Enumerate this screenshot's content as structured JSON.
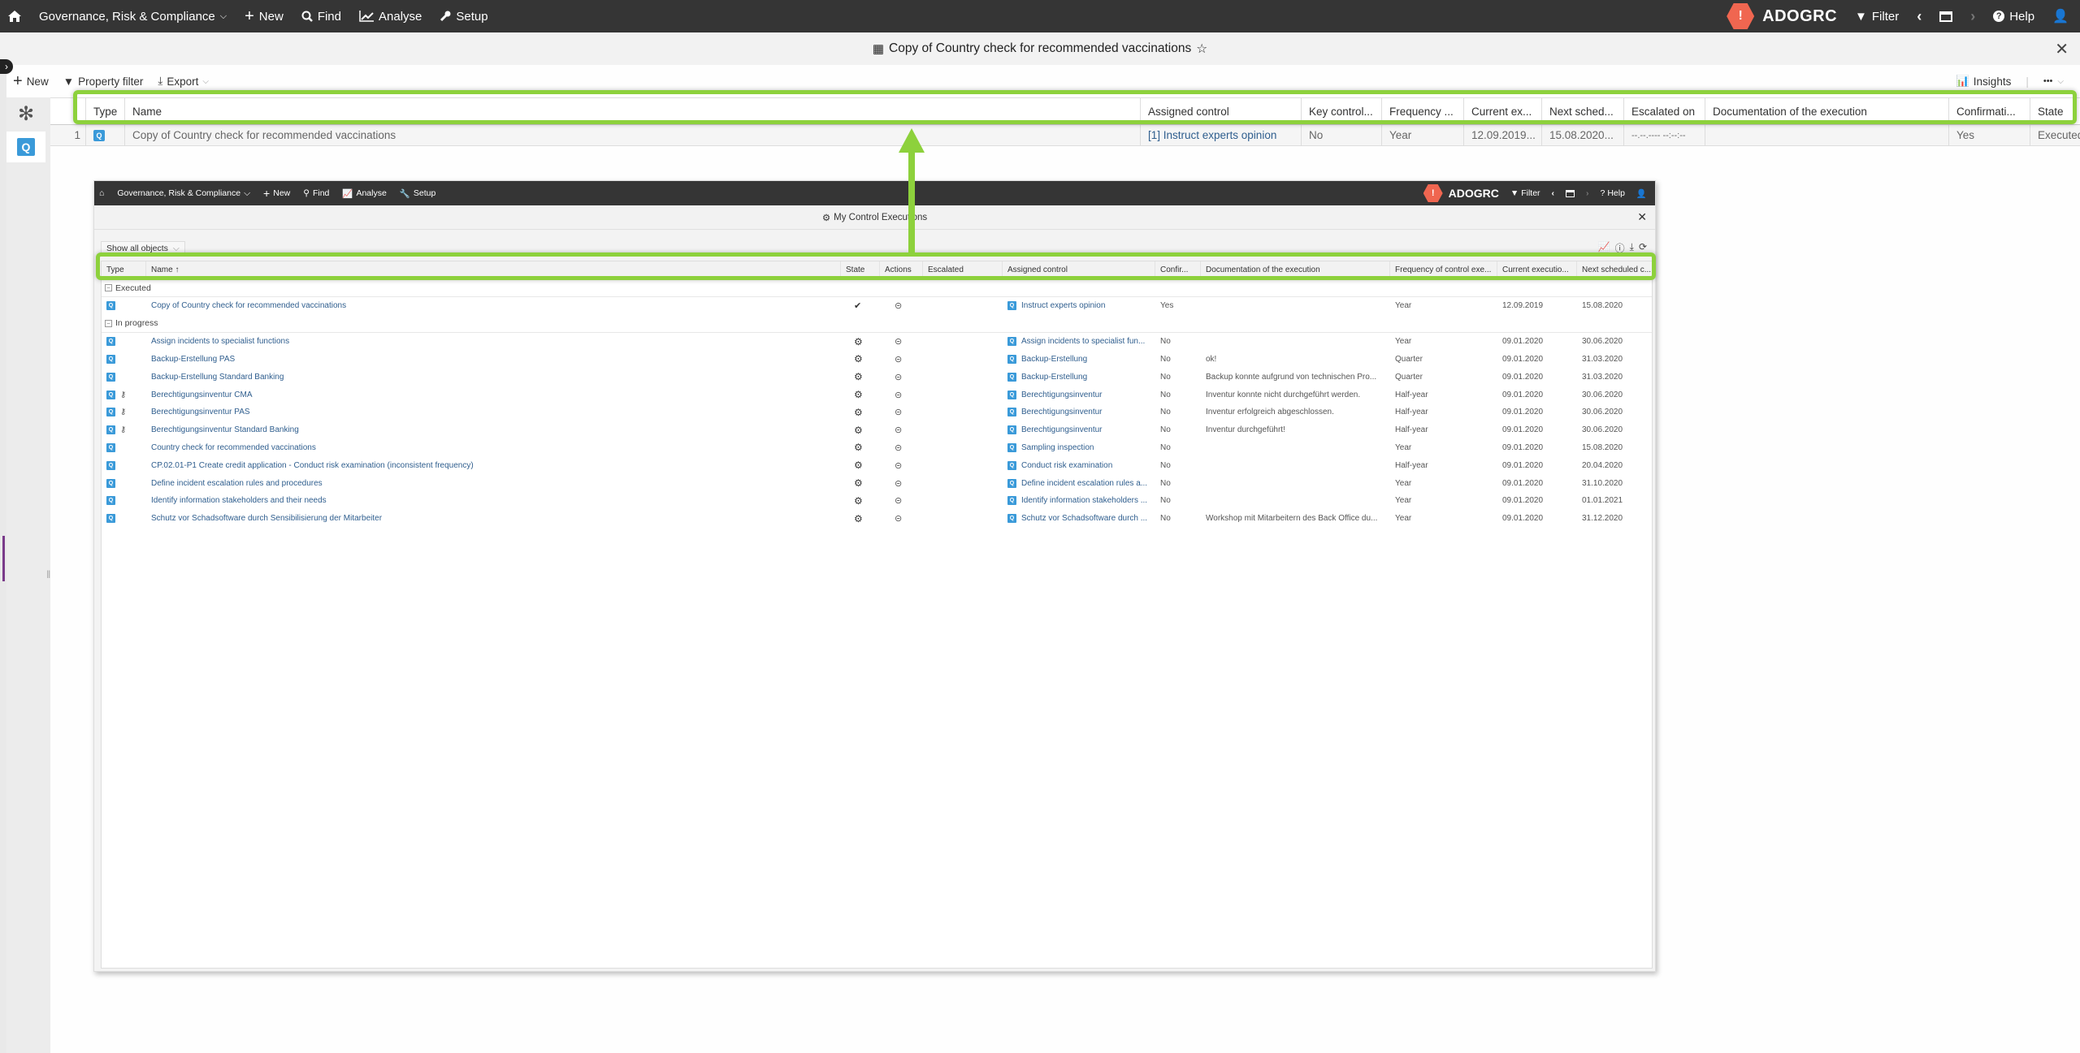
{
  "topnav": {
    "app_menu": "Governance, Risk & Compliance",
    "new": "New",
    "find": "Find",
    "analyse": "Analyse",
    "setup": "Setup",
    "logo": "ADOGRC",
    "filter": "Filter",
    "help": "Help"
  },
  "titlebar": {
    "title": "Copy of Country check for recommended vaccinations",
    "star": "☆",
    "close": "✕"
  },
  "toolbar": {
    "new": "New",
    "property_filter": "Property filter",
    "export": "Export",
    "insights": "Insights",
    "more": "•••"
  },
  "main_table": {
    "headers": [
      "Type",
      "Name",
      "Assigned control",
      "Key control...",
      "Frequency ...",
      "Current ex...",
      "Next sched...",
      "Escalated on",
      "Documentation of the execution",
      "Confirmati...",
      "State"
    ],
    "rows": [
      {
        "num": "1",
        "name": "Copy of Country check for recommended vaccinations",
        "assigned": "[1] Instruct experts opinion",
        "key": "No",
        "freq": "Year",
        "current": "12.09.2019...",
        "next": "15.08.2020...",
        "escalated": "--.--.---- --:--:--",
        "doc": "",
        "confirm": "Yes",
        "state": "Executed"
      }
    ]
  },
  "inner": {
    "nav": {
      "app_menu": "Governance, Risk & Compliance",
      "new": "New",
      "find": "Find",
      "analyse": "Analyse",
      "setup": "Setup",
      "logo": "ADOGRC",
      "filter": "Filter",
      "help": "Help"
    },
    "title": "My Control Executions",
    "show_all": "Show all objects",
    "headers": [
      "Type",
      "Name ↑",
      "State",
      "Actions",
      "Escalated",
      "Assigned control",
      "Confir...",
      "Documentation of the execution",
      "Frequency of control exe...",
      "Current executio...",
      "Next scheduled c..."
    ],
    "groups": [
      {
        "label": "Executed",
        "rows": [
          {
            "key": false,
            "name": "Copy of Country check for recommended vaccinations",
            "state": "done",
            "assigned": "Instruct experts opinion",
            "confirm": "Yes",
            "doc": "",
            "freq": "Year",
            "current": "12.09.2019",
            "next": "15.08.2020"
          }
        ]
      },
      {
        "label": "In progress",
        "rows": [
          {
            "key": false,
            "name": "Assign incidents to specialist functions",
            "state": "gear",
            "assigned": "Assign incidents to specialist fun...",
            "confirm": "No",
            "doc": "",
            "freq": "Year",
            "current": "09.01.2020",
            "next": "30.06.2020"
          },
          {
            "key": false,
            "name": "Backup-Erstellung PAS",
            "state": "gear",
            "assigned": "Backup-Erstellung",
            "confirm": "No",
            "doc": "ok!",
            "freq": "Quarter",
            "current": "09.01.2020",
            "next": "31.03.2020"
          },
          {
            "key": false,
            "name": "Backup-Erstellung Standard Banking",
            "state": "gear",
            "assigned": "Backup-Erstellung",
            "confirm": "No",
            "doc": "Backup konnte aufgrund von technischen Pro...",
            "freq": "Quarter",
            "current": "09.01.2020",
            "next": "31.03.2020"
          },
          {
            "key": true,
            "name": "Berechtigungsinventur CMA",
            "state": "gear",
            "assigned": "Berechtigungsinventur",
            "confirm": "No",
            "doc": "Inventur konnte nicht durchgeführt werden.",
            "freq": "Half-year",
            "current": "09.01.2020",
            "next": "30.06.2020"
          },
          {
            "key": true,
            "name": "Berechtigungsinventur PAS",
            "state": "gear",
            "assigned": "Berechtigungsinventur",
            "confirm": "No",
            "doc": "Inventur erfolgreich abgeschlossen.",
            "freq": "Half-year",
            "current": "09.01.2020",
            "next": "30.06.2020"
          },
          {
            "key": true,
            "name": "Berechtigungsinventur Standard Banking",
            "state": "gear",
            "assigned": "Berechtigungsinventur",
            "confirm": "No",
            "doc": "Inventur durchgeführt!",
            "freq": "Half-year",
            "current": "09.01.2020",
            "next": "30.06.2020"
          },
          {
            "key": false,
            "name": "Country check for recommended vaccinations",
            "state": "gear",
            "assigned": "Sampling inspection",
            "confirm": "No",
            "doc": "",
            "freq": "Year",
            "current": "09.01.2020",
            "next": "15.08.2020"
          },
          {
            "key": false,
            "name": "CP.02.01-P1 Create credit application - Conduct risk examination (inconsistent frequency)",
            "state": "gear",
            "assigned": "Conduct risk examination",
            "confirm": "No",
            "doc": "",
            "freq": "Half-year",
            "current": "09.01.2020",
            "next": "20.04.2020"
          },
          {
            "key": false,
            "name": "Define incident escalation rules and procedures",
            "state": "gear",
            "assigned": "Define incident escalation rules a...",
            "confirm": "No",
            "doc": "",
            "freq": "Year",
            "current": "09.01.2020",
            "next": "31.10.2020"
          },
          {
            "key": false,
            "name": "Identify information stakeholders and their needs",
            "state": "gear",
            "assigned": "Identify information stakeholders ...",
            "confirm": "No",
            "doc": "",
            "freq": "Year",
            "current": "09.01.2020",
            "next": "01.01.2021"
          },
          {
            "key": false,
            "name": "Schutz vor Schadsoftware durch Sensibilisierung der Mitarbeiter",
            "state": "gear",
            "assigned": "Schutz vor Schadsoftware durch ...",
            "confirm": "No",
            "doc": "Workshop mit Mitarbeitern des Back Office du...",
            "freq": "Year",
            "current": "09.01.2020",
            "next": "31.12.2020"
          }
        ]
      }
    ]
  },
  "colors": {
    "highlight": "#8dd13c",
    "nav_bg": "#353535",
    "logo": "#f06650",
    "type_icon": "#3a9ad9",
    "link": "#2f5e8e"
  }
}
